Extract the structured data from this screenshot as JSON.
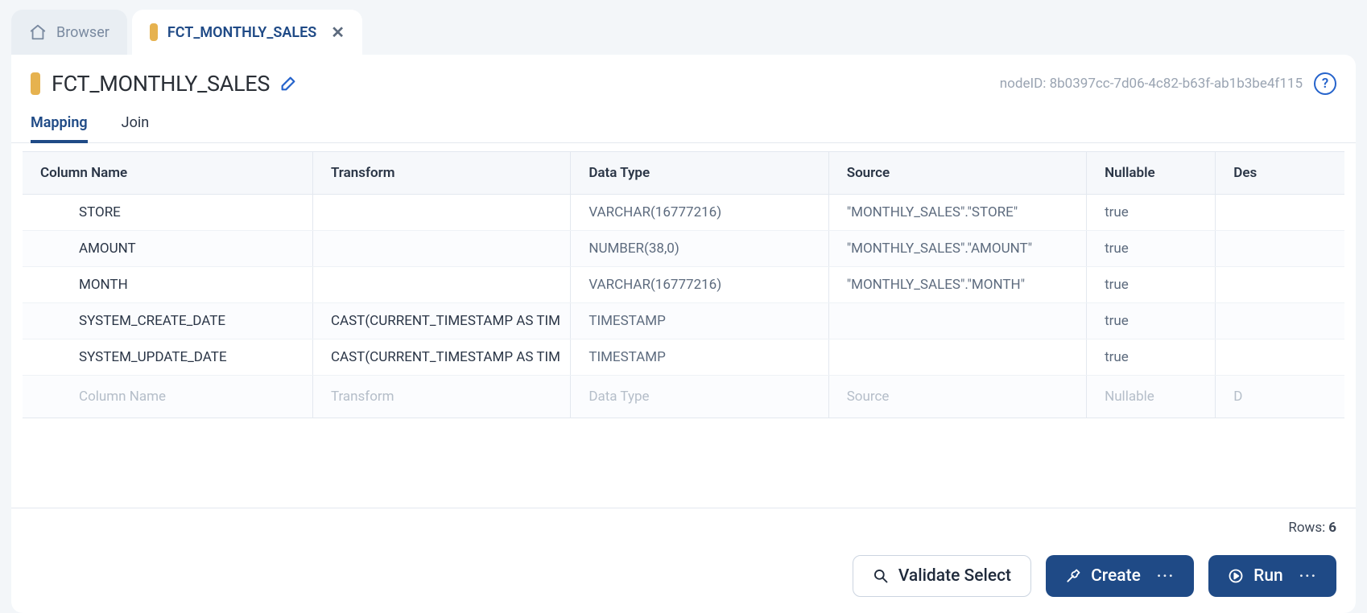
{
  "top_tabs": {
    "browser_label": "Browser",
    "fct_label": "FCT_MONTHLY_SALES"
  },
  "header": {
    "title": "FCT_MONTHLY_SALES",
    "node_id_label": "nodeID: 8b0397cc-7d06-4c82-b63f-ab1b3be4f115",
    "help": "?"
  },
  "subtabs": {
    "mapping": "Mapping",
    "join": "Join"
  },
  "columns": {
    "name": "Column Name",
    "transform": "Transform",
    "data_type": "Data Type",
    "source": "Source",
    "nullable": "Nullable",
    "description": "Des"
  },
  "rows": [
    {
      "name": "STORE",
      "transform": "",
      "data_type": "VARCHAR(16777216)",
      "source": "\"MONTHLY_SALES\".\"STORE\"",
      "nullable": "true"
    },
    {
      "name": "AMOUNT",
      "transform": "",
      "data_type": "NUMBER(38,0)",
      "source": "\"MONTHLY_SALES\".\"AMOUNT\"",
      "nullable": "true"
    },
    {
      "name": "MONTH",
      "transform": "",
      "data_type": "VARCHAR(16777216)",
      "source": "\"MONTHLY_SALES\".\"MONTH\"",
      "nullable": "true"
    },
    {
      "name": "SYSTEM_CREATE_DATE",
      "transform": "CAST(CURRENT_TIMESTAMP AS TIM",
      "data_type": "TIMESTAMP",
      "source": "",
      "nullable": "true"
    },
    {
      "name": "SYSTEM_UPDATE_DATE",
      "transform": "CAST(CURRENT_TIMESTAMP AS TIM",
      "data_type": "TIMESTAMP",
      "source": "",
      "nullable": "true"
    }
  ],
  "placeholder": {
    "name": "Column Name",
    "transform": "Transform",
    "data_type": "Data Type",
    "source": "Source",
    "nullable": "Nullable",
    "description": "D"
  },
  "status": {
    "rows_label": "Rows:",
    "rows_count": "6"
  },
  "buttons": {
    "validate": "Validate Select",
    "create": "Create",
    "run": "Run",
    "more": "···"
  }
}
